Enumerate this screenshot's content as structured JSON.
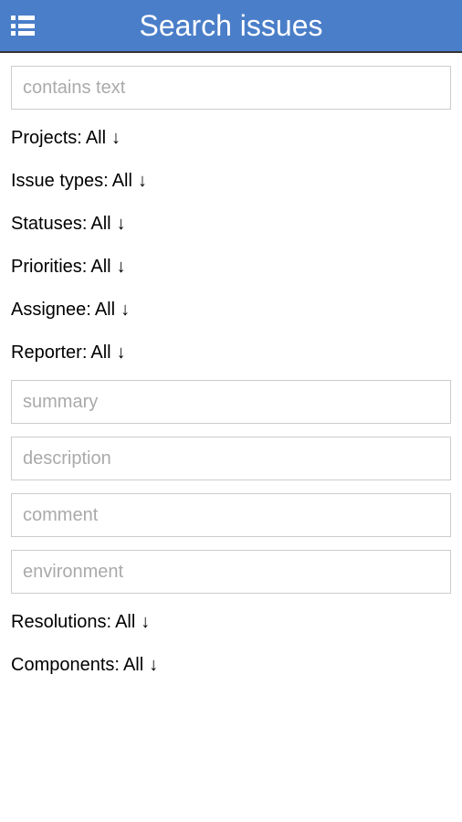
{
  "header": {
    "title": "Search issues"
  },
  "search": {
    "contains_text": {
      "placeholder": "contains text",
      "value": ""
    },
    "summary": {
      "placeholder": "summary",
      "value": ""
    },
    "description": {
      "placeholder": "description",
      "value": ""
    },
    "comment": {
      "placeholder": "comment",
      "value": ""
    },
    "environment": {
      "placeholder": "environment",
      "value": ""
    }
  },
  "filters": {
    "projects": {
      "label": "Projects:",
      "value": "All",
      "arrow": "↓"
    },
    "issue_types": {
      "label": "Issue types:",
      "value": "All",
      "arrow": "↓"
    },
    "statuses": {
      "label": "Statuses:",
      "value": "All",
      "arrow": "↓"
    },
    "priorities": {
      "label": "Priorities:",
      "value": "All",
      "arrow": "↓"
    },
    "assignee": {
      "label": "Assignee:",
      "value": "All",
      "arrow": "↓"
    },
    "reporter": {
      "label": "Reporter:",
      "value": "All",
      "arrow": "↓"
    },
    "resolutions": {
      "label": "Resolutions:",
      "value": "All",
      "arrow": "↓"
    },
    "components": {
      "label": "Components:",
      "value": "All",
      "arrow": "↓"
    }
  }
}
